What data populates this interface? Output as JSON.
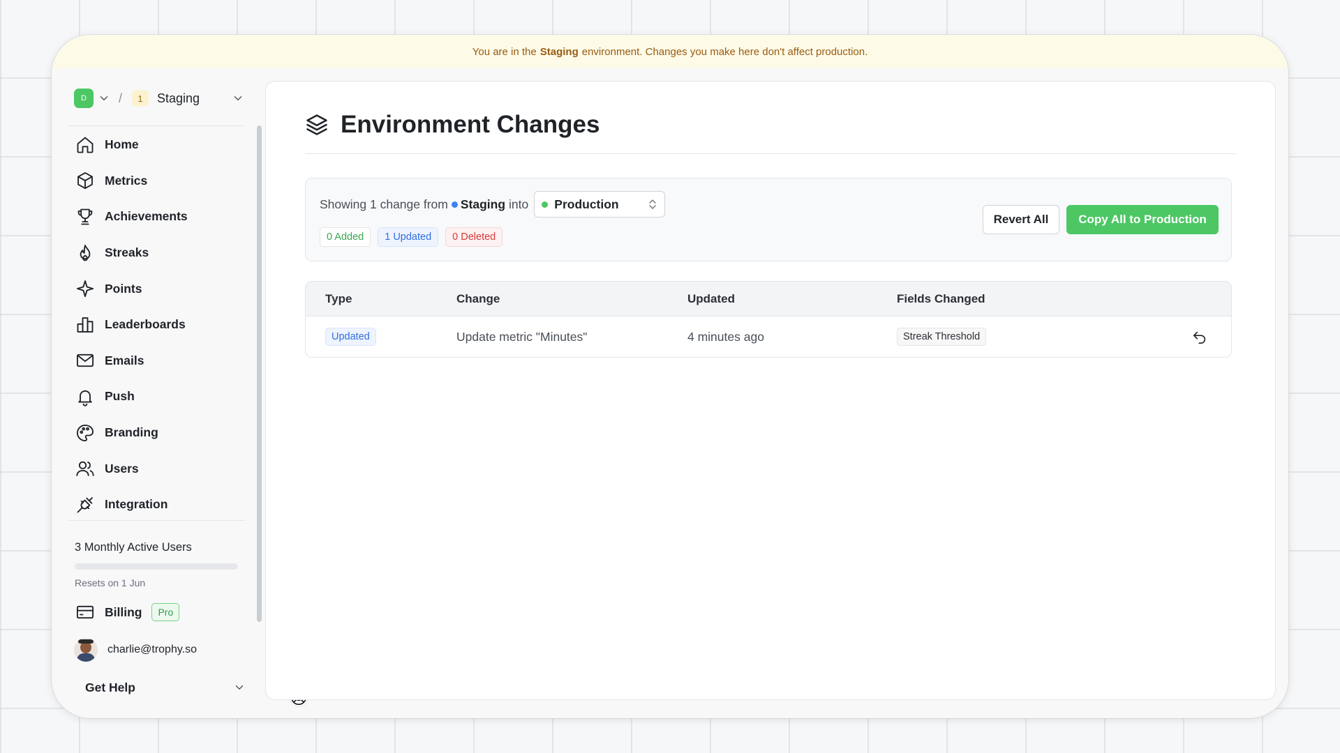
{
  "banner": {
    "prefix": "You are in the",
    "env": "Staging",
    "suffix": "environment. Changes you make here don't affect production."
  },
  "env_switcher": {
    "org_initial": "D",
    "env_initial": "1",
    "env_name": "Staging"
  },
  "nav": [
    {
      "label": "Home",
      "icon": "home-icon"
    },
    {
      "label": "Metrics",
      "icon": "cube-icon"
    },
    {
      "label": "Achievements",
      "icon": "trophy-icon"
    },
    {
      "label": "Streaks",
      "icon": "flame-icon"
    },
    {
      "label": "Points",
      "icon": "sparkle-icon"
    },
    {
      "label": "Leaderboards",
      "icon": "podium-icon"
    },
    {
      "label": "Emails",
      "icon": "mail-icon"
    },
    {
      "label": "Push",
      "icon": "bell-icon"
    },
    {
      "label": "Branding",
      "icon": "palette-icon"
    },
    {
      "label": "Users",
      "icon": "users-icon"
    },
    {
      "label": "Integration",
      "icon": "plug-icon"
    }
  ],
  "usage": {
    "label": "3 Monthly Active Users",
    "progress_fraction": 0.0,
    "resets": "Resets on 1 Jun"
  },
  "billing": {
    "label": "Billing",
    "plan": "Pro"
  },
  "account": {
    "email": "charlie@trophy.so"
  },
  "help": {
    "label": "Get Help"
  },
  "page": {
    "title": "Environment Changes"
  },
  "summary": {
    "prefix": "Showing 1 change from",
    "source_env": "Staging",
    "into": "into",
    "target_env": "Production",
    "added": "0 Added",
    "updated": "1 Updated",
    "deleted": "0 Deleted",
    "revert_all": "Revert All",
    "copy_all": "Copy All to Production"
  },
  "table": {
    "columns": [
      "Type",
      "Change",
      "Updated",
      "Fields Changed"
    ],
    "rows": [
      {
        "type": "Updated",
        "change": "Update metric \"Minutes\"",
        "updated": "4 minutes ago",
        "fields": "Streak Threshold"
      }
    ]
  },
  "colors": {
    "accent": "#4cc764",
    "staging": "#3b82f6",
    "banner_bg": "#fdfbe8",
    "banner_text": "#9a5b12"
  }
}
